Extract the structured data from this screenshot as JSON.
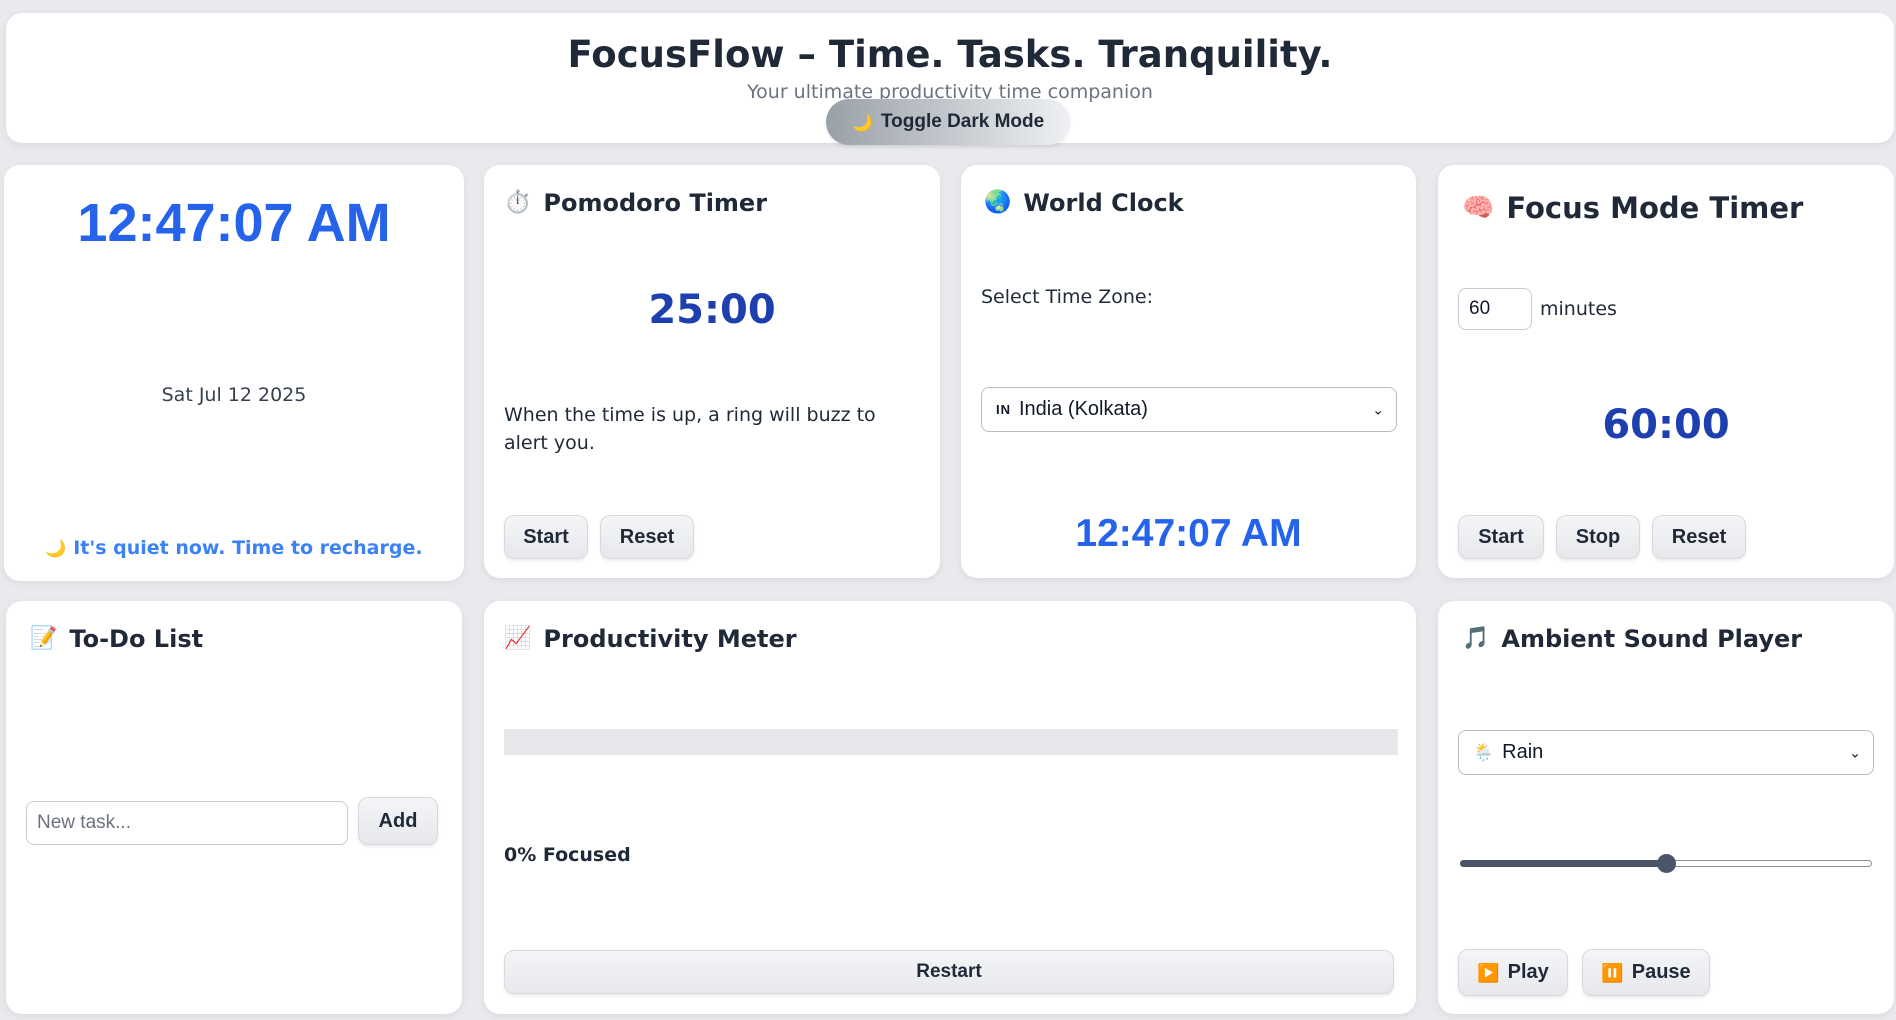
{
  "header": {
    "title": "FocusFlow – Time. Tasks. Tranquility.",
    "subtitle": "Your ultimate productivity time companion",
    "toggle_icon": "🌙",
    "toggle_label": "Toggle Dark Mode"
  },
  "clock": {
    "time": "12:47:07 AM",
    "date": "Sat Jul 12 2025",
    "message_icon": "🌙",
    "message": "It's quiet now. Time to recharge."
  },
  "pomodoro": {
    "icon": "⏱️",
    "title": "Pomodoro Timer",
    "time": "25:00",
    "note": "When the time is up, a ring will buzz to alert you.",
    "start_label": "Start",
    "reset_label": "Reset"
  },
  "world_clock": {
    "icon": "🌏",
    "title": "World Clock",
    "select_label": "Select Time Zone:",
    "selected_flag": "IN",
    "selected_zone": "India (Kolkata)",
    "time": "12:47:07 AM"
  },
  "focus_timer": {
    "icon": "🧠",
    "title": "Focus Mode Timer",
    "minutes_value": "60",
    "minutes_label": "minutes",
    "time": "60:00",
    "start_label": "Start",
    "stop_label": "Stop",
    "reset_label": "Reset"
  },
  "todo": {
    "icon": "📝",
    "title": "To-Do List",
    "placeholder": "New task...",
    "add_label": "Add"
  },
  "productivity": {
    "icon": "📈",
    "title": "Productivity Meter",
    "progress_fraction": 0,
    "focused_text": "0% Focused",
    "restart_label": "Restart"
  },
  "ambient": {
    "icon": "🎵",
    "title": "Ambient Sound Player",
    "selected_icon": "🌦️",
    "selected_sound": "Rain",
    "volume_fraction": 0.5,
    "play_icon": "▶️",
    "play_label": "Play",
    "pause_icon": "⏸️",
    "pause_label": "Pause"
  },
  "colors": {
    "accent_blue": "#1e40af",
    "clock_blue": "#2563eb",
    "background": "#e9eaee"
  }
}
